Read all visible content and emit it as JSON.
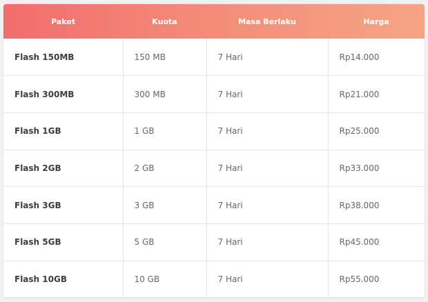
{
  "table": {
    "headers": [
      "Paket",
      "Kuota",
      "Masa Berlaku",
      "Harga"
    ],
    "rows": [
      [
        "Flash 150MB",
        "150 MB",
        "7 Hari",
        "Rp14.000"
      ],
      [
        "Flash 300MB",
        "300 MB",
        "7 Hari",
        "Rp21.000"
      ],
      [
        "Flash 1GB",
        "1 GB",
        "7 Hari",
        "Rp25.000"
      ],
      [
        "Flash 2GB",
        "2 GB",
        "7 Hari",
        "Rp33.000"
      ],
      [
        "Flash 3GB",
        "3 GB",
        "7 Hari",
        "Rp38.000"
      ],
      [
        "Flash 5GB",
        "5 GB",
        "7 Hari",
        "Rp45.000"
      ],
      [
        "Flash 10GB",
        "10 GB",
        "7 Hari",
        "Rp55.000"
      ]
    ]
  },
  "colors": {
    "header_gradient_start": "#f26d6d",
    "header_gradient_end": "#f6a584"
  }
}
